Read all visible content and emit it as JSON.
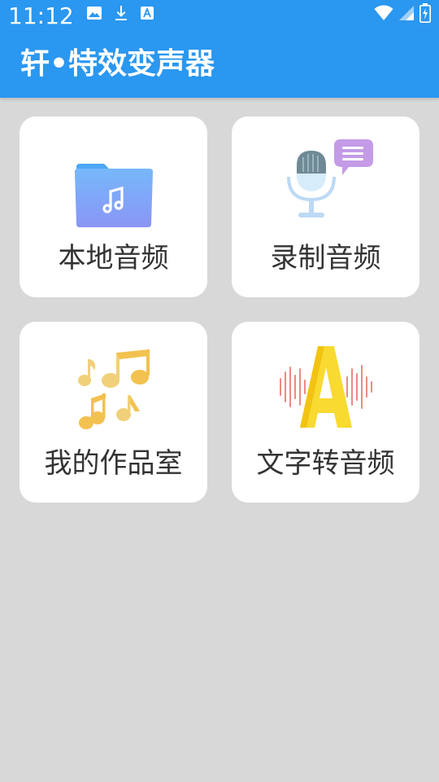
{
  "status_bar": {
    "time": "11:12",
    "left_icons": [
      "image-icon",
      "download-icon",
      "accessibility-icon"
    ],
    "right_icons": [
      "wifi-icon",
      "signal-icon",
      "battery-icon"
    ]
  },
  "app_bar": {
    "title": "轩•特效变声器"
  },
  "cards": [
    {
      "label": "本地音频",
      "icon": "folder-music-icon"
    },
    {
      "label": "录制音频",
      "icon": "microphone-chat-icon"
    },
    {
      "label": "我的作品室",
      "icon": "music-notes-icon"
    },
    {
      "label": "文字转音频",
      "icon": "text-audio-icon"
    }
  ],
  "colors": {
    "primary": "#2a97f0",
    "background": "#d8d8d8",
    "card": "#ffffff",
    "text": "#333333"
  }
}
